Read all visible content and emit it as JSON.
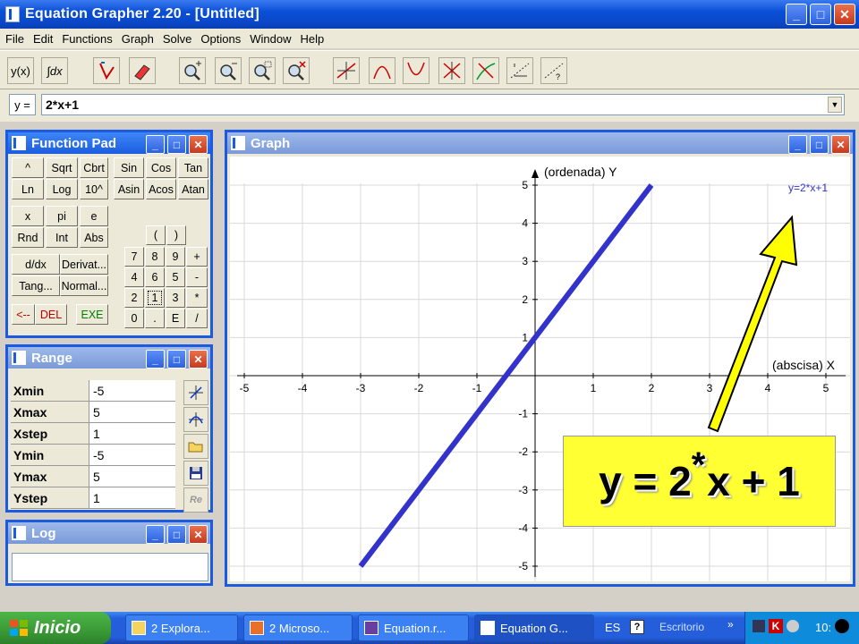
{
  "window": {
    "title": "Equation Grapher 2.20 - [Untitled]",
    "minimize": "_",
    "maximize": "□",
    "close": "✕"
  },
  "menu": [
    "File",
    "Edit",
    "Functions",
    "Graph",
    "Solve",
    "Options",
    "Window",
    "Help"
  ],
  "toolbar": {
    "yx": "y(x)",
    "integral": "∫dx"
  },
  "formula_bar": {
    "label": "y =",
    "value": "2*x+1"
  },
  "function_pad": {
    "title": "Function Pad",
    "row1": [
      "^",
      "Sqrt",
      "Cbrt",
      "Sin",
      "Cos",
      "Tan"
    ],
    "row2": [
      "Ln",
      "Log",
      "10^",
      "Asin",
      "Acos",
      "Atan"
    ],
    "row3": [
      "x",
      "pi",
      "e"
    ],
    "row4": [
      "Rnd",
      "Int",
      "Abs"
    ],
    "row5": [
      "d/dx",
      "Derivat..."
    ],
    "row6": [
      "Tang...",
      "Normal..."
    ],
    "row7": [
      "<--",
      "DEL",
      "EXE"
    ],
    "parens": [
      "(",
      ")"
    ],
    "numpad": [
      "7",
      "8",
      "9",
      "+",
      "4",
      "6",
      "5",
      "-",
      "2",
      "1",
      "3",
      "*",
      "0",
      ".",
      "E",
      "/"
    ]
  },
  "range": {
    "title": "Range",
    "rows": [
      {
        "name": "Xmin",
        "value": "-5"
      },
      {
        "name": "Xmax",
        "value": "5"
      },
      {
        "name": "Xstep",
        "value": "1"
      },
      {
        "name": "Ymin",
        "value": "-5"
      },
      {
        "name": "Ymax",
        "value": "5"
      },
      {
        "name": "Ystep",
        "value": "1"
      }
    ],
    "reset": "Re"
  },
  "log": {
    "title": "Log"
  },
  "graph": {
    "title": "Graph",
    "legend": "y=2*x+1",
    "ylabel": "(ordenada) Y",
    "xlabel": "(abscisa) X",
    "line_color": "#3333cc"
  },
  "chart_data": {
    "type": "line",
    "series": [
      {
        "name": "y=2*x+1",
        "x": [
          -3,
          2
        ],
        "y": [
          -5,
          5
        ]
      }
    ],
    "xlim": [
      -5,
      5
    ],
    "ylim": [
      -5,
      5
    ],
    "xticks": [
      "-5",
      "-4",
      "-3",
      "-2",
      "-1",
      "1",
      "2",
      "3",
      "4",
      "5"
    ],
    "yticks": [
      "5",
      "4",
      "3",
      "2",
      "1",
      "-1",
      "-2",
      "-3",
      "-4",
      "-5"
    ],
    "xlabel": "(abscisa) X",
    "ylabel": "(ordenada) Y",
    "grid": true
  },
  "callout": {
    "left": "y = 2",
    "star": "*",
    "right": "x + 1",
    "background": "#ffff33",
    "arrow_color": "#ffff00"
  },
  "taskbar": {
    "start": "Inicio",
    "tasks": [
      "2 Explora...",
      "2 Microso...",
      "Equation.r...",
      "Equation G..."
    ],
    "lang": "ES",
    "desktop": "Escritorio",
    "clock": "10:"
  }
}
